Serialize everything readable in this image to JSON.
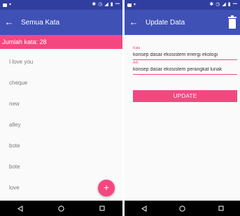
{
  "left_screen": {
    "toolbar": {
      "title": "Semua Kata",
      "back_icon": "arrow-back-icon"
    },
    "count_banner": "Jumlah kata: 28",
    "words": [
      "I love you",
      "cheque",
      "new",
      "alley",
      "bote",
      "bote",
      "love"
    ],
    "fab_label": "+"
  },
  "right_screen": {
    "toolbar": {
      "title": "Update Data",
      "back_icon": "arrow-back-icon",
      "action_icon": "delete-icon"
    },
    "field_1": {
      "label": "Kata",
      "value": "konsep dasar ekosistem energi ekologi"
    },
    "field_2": {
      "label": "Arti",
      "value": "konsep dasar ekosistem perangkat lunak"
    },
    "update_label": "UPDATE"
  },
  "colors": {
    "primary": "#3f51b5",
    "primary_dark": "#303f9f",
    "accent": "#f44780",
    "nav_bar": "#000000"
  }
}
